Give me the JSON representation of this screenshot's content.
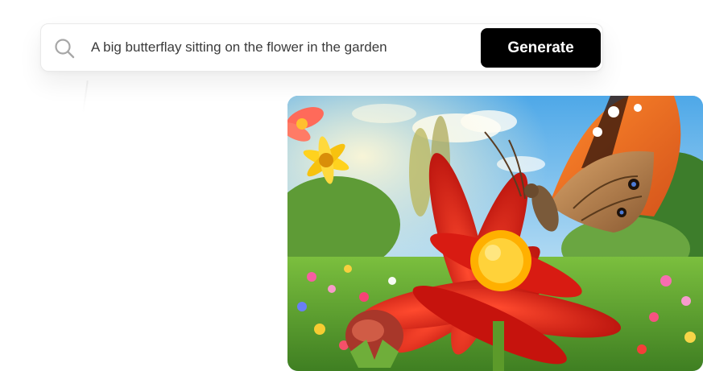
{
  "prompt_bar": {
    "icon": "search-icon",
    "prompt_text": "A big butterflay sitting on the flower in the garden",
    "generate_label": "Generate"
  },
  "generated_image": {
    "icon": "butterfly-on-red-flower-image"
  },
  "colors": {
    "button_bg": "#000000",
    "button_text": "#ffffff",
    "prompt_text": "#3b3b3b",
    "card_border": "#e9e9e9"
  }
}
